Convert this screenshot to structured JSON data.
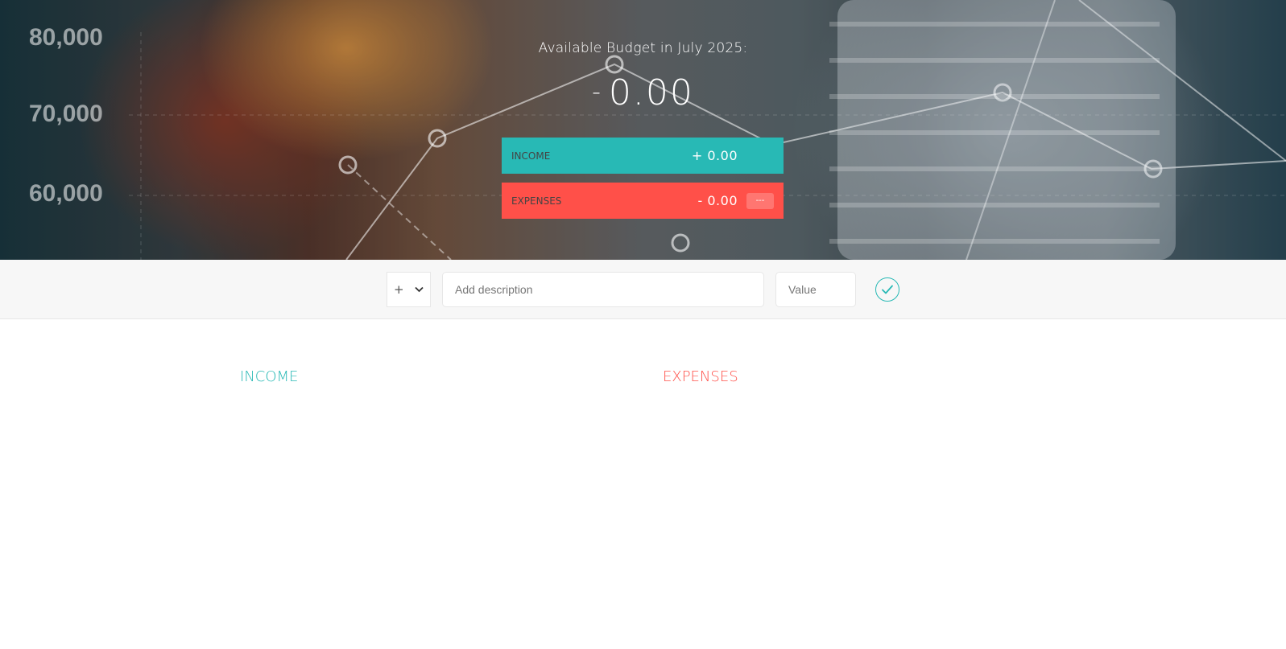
{
  "budget": {
    "title": "Available Budget in July 2025:",
    "sign": "-",
    "value": "0.00"
  },
  "summary": {
    "income_label": "INCOME",
    "income_value": "+ 0.00",
    "expenses_label": "EXPENSES",
    "expenses_value": "- 0.00",
    "expenses_percentage": "---"
  },
  "add": {
    "type_selected": "+",
    "description_placeholder": "Add description",
    "value_placeholder": "Value"
  },
  "lists": {
    "income_title": "INCOME",
    "expenses_title": "EXPENSES"
  },
  "background_text": {
    "tick_1": "80,000",
    "tick_2": "70,000",
    "tick_3": "60,000"
  },
  "colors": {
    "income": "#28b9b5",
    "expenses": "#ff5049"
  }
}
